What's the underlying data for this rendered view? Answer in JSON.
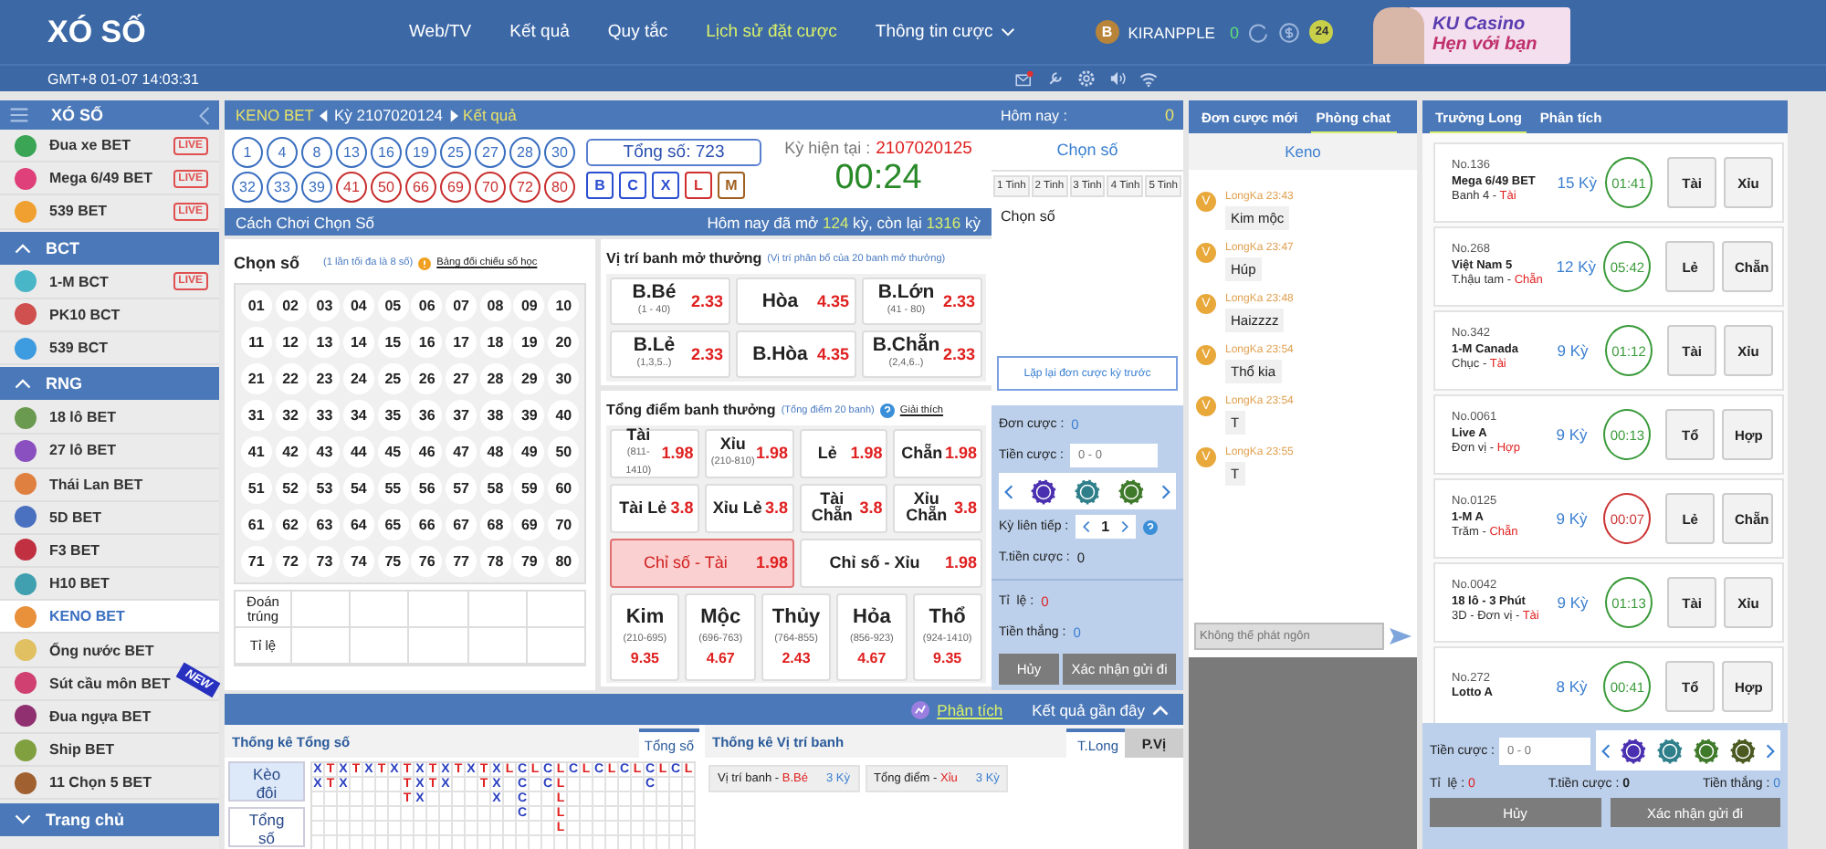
{
  "header": {
    "logo": "XÓ SỐ",
    "nav": [
      {
        "label": "Web/TV",
        "selected": false,
        "dropdown": false
      },
      {
        "label": "Kết quả",
        "selected": false,
        "dropdown": false
      },
      {
        "label": "Quy tắc",
        "selected": false,
        "dropdown": false
      },
      {
        "label": "Lịch sử đặt cược",
        "selected": true,
        "dropdown": false
      },
      {
        "label": "Thông tin cược",
        "selected": false,
        "dropdown": true
      }
    ],
    "user": {
      "initial": "B",
      "name": "KIRANPPLE",
      "balance": "0",
      "badge": "24"
    },
    "banner": {
      "title": "KU Casino",
      "subtitle": "Hẹn với bạn"
    },
    "clock": "GMT+8 01-07 14:03:31",
    "mail_unread": true
  },
  "sidebar": {
    "title": "XÓ SỐ",
    "footer": "Trang chủ",
    "groups": [
      {
        "items": [
          {
            "label": "Đua xe BET",
            "color": "#3aa655",
            "live": "LIVE",
            "selected": false
          },
          {
            "label": "Mega 6/49 BET",
            "color": "#e0407a",
            "live": "LIVE",
            "selected": false
          },
          {
            "label": "539 BET",
            "color": "#f0a030",
            "live": "LIVE",
            "selected": false
          }
        ]
      },
      {
        "title": "BCT",
        "expanded": true,
        "items": [
          {
            "label": "1-M BCT",
            "color": "#49b6c8",
            "live": "LIVE",
            "selected": false
          },
          {
            "label": "PK10 BCT",
            "color": "#d0504f",
            "selected": false
          },
          {
            "label": "539 BCT",
            "color": "#3d9be0",
            "selected": false
          }
        ]
      },
      {
        "title": "RNG",
        "expanded": true,
        "items": [
          {
            "label": "18 lô BET",
            "color": "#6a9a50",
            "selected": false
          },
          {
            "label": "27 lô BET",
            "color": "#8a50c0",
            "selected": false
          },
          {
            "label": "Thái Lan BET",
            "color": "#e08040",
            "selected": false
          },
          {
            "label": "5D BET",
            "color": "#4a70c0",
            "selected": false
          },
          {
            "label": "F3 BET",
            "color": "#c03040",
            "selected": false
          },
          {
            "label": "H10 BET",
            "color": "#40a0b0",
            "selected": false
          },
          {
            "label": "KENO BET",
            "color": "#e8903a",
            "selected": true
          },
          {
            "label": "Ống nước BET",
            "color": "#e0c060",
            "selected": false
          },
          {
            "label": "Sút cầu môn BET",
            "color": "#d04070",
            "new": "NEW",
            "selected": false
          },
          {
            "label": "Đua ngựa BET",
            "color": "#903070",
            "selected": false
          },
          {
            "label": "Ship BET",
            "color": "#80a040",
            "selected": false
          },
          {
            "label": "11 Chọn 5 BET",
            "color": "#a06030",
            "selected": false
          }
        ]
      }
    ]
  },
  "keno": {
    "breadcrumb": {
      "game": "KENO BET",
      "period": "Kỳ 2107020124",
      "result_link": "Kết quả"
    },
    "results": {
      "balls": [
        {
          "n": "1",
          "color": "#3a6fc0"
        },
        {
          "n": "4",
          "color": "#3a6fc0"
        },
        {
          "n": "8",
          "color": "#3a6fc0"
        },
        {
          "n": "13",
          "color": "#3a6fc0"
        },
        {
          "n": "16",
          "color": "#3a6fc0"
        },
        {
          "n": "19",
          "color": "#3a6fc0"
        },
        {
          "n": "25",
          "color": "#3a6fc0"
        },
        {
          "n": "27",
          "color": "#3a6fc0"
        },
        {
          "n": "28",
          "color": "#3a6fc0"
        },
        {
          "n": "30",
          "color": "#3a6fc0"
        },
        {
          "n": "32",
          "color": "#3a6fc0"
        },
        {
          "n": "33",
          "color": "#3a6fc0"
        },
        {
          "n": "39",
          "color": "#3a6fc0"
        },
        {
          "n": "41",
          "color": "#c83030"
        },
        {
          "n": "50",
          "color": "#c83030"
        },
        {
          "n": "66",
          "color": "#c83030"
        },
        {
          "n": "69",
          "color": "#c83030"
        },
        {
          "n": "70",
          "color": "#c83030"
        },
        {
          "n": "72",
          "color": "#c83030"
        },
        {
          "n": "80",
          "color": "#c83030"
        }
      ],
      "total": "Tổng số: 723",
      "flags": [
        {
          "label": "B",
          "color": "#2a4fd0"
        },
        {
          "label": "C",
          "color": "#2a4fd0"
        },
        {
          "label": "X",
          "color": "#2a4fd0"
        },
        {
          "label": "L",
          "color": "#d03030"
        },
        {
          "label": "M",
          "color": "#a06020"
        }
      ],
      "current_label": "Kỳ hiện tại :",
      "current_period": "2107020125",
      "countdown": "00:24"
    },
    "bar": {
      "title": "Cách Chơi Chọn Số",
      "stats": [
        {
          "text": "Hôm nay đã mở ",
          "highlight": false
        },
        {
          "text": "124",
          "highlight": true
        },
        {
          "text": " kỳ, còn lại ",
          "highlight": false
        },
        {
          "text": "1316",
          "highlight": true
        },
        {
          "text": " kỳ",
          "highlight": false
        }
      ]
    },
    "picker": {
      "title": "Chọn số",
      "hint": "(1 lần tối đa là 8 số)",
      "link": "Bảng đối chiếu số học",
      "numbers": [
        "01",
        "02",
        "03",
        "04",
        "05",
        "06",
        "07",
        "08",
        "09",
        "10",
        "11",
        "12",
        "13",
        "14",
        "15",
        "16",
        "17",
        "18",
        "19",
        "20",
        "21",
        "22",
        "23",
        "24",
        "25",
        "26",
        "27",
        "28",
        "29",
        "30",
        "31",
        "32",
        "33",
        "34",
        "35",
        "36",
        "37",
        "38",
        "39",
        "40",
        "41",
        "42",
        "43",
        "44",
        "45",
        "46",
        "47",
        "48",
        "49",
        "50",
        "51",
        "52",
        "53",
        "54",
        "55",
        "56",
        "57",
        "58",
        "59",
        "60",
        "61",
        "62",
        "63",
        "64",
        "65",
        "66",
        "67",
        "68",
        "69",
        "70",
        "71",
        "72",
        "73",
        "74",
        "75",
        "76",
        "77",
        "78",
        "79",
        "80"
      ],
      "hit_label": "Đoán trúng",
      "rate_label": "Tỉ lệ"
    },
    "positions": {
      "title": "Vị trí banh mở thưởng",
      "note": "(Vị trí phân bổ của 20 banh mở thưởng)",
      "bets": [
        {
          "name": "B.Bé",
          "range": "(1 - 40)",
          "odds": "2.33",
          "selected": false
        },
        {
          "name": "Hòa",
          "odds": "4.35",
          "selected": false
        },
        {
          "name": "B.Lớn",
          "range": "(41 - 80)",
          "odds": "2.33",
          "selected": false
        },
        {
          "name": "B.Lẻ",
          "range": "(1,3,5..)",
          "odds": "2.33",
          "selected": false
        },
        {
          "name": "B.Hòa",
          "odds": "4.35",
          "selected": false
        },
        {
          "name": "B.Chẵn",
          "range": "(2,4,6..)",
          "odds": "2.33",
          "selected": false
        }
      ]
    },
    "totals": {
      "title": "Tổng điểm banh thưởng",
      "note": "(Tổng điểm 20 banh)",
      "help_link": "Giải thích",
      "main_bets": [
        {
          "kind": "plain",
          "name": "Tài",
          "range": "(811-1410)",
          "odds": "1.98",
          "selected": false
        },
        {
          "kind": "plain",
          "name": "Xỉu",
          "range": "(210-810)",
          "odds": "1.98",
          "selected": false
        },
        {
          "kind": "plain",
          "name": "Lẻ",
          "odds": "1.98",
          "selected": false
        },
        {
          "kind": "plain",
          "name": "Chẵn",
          "odds": "1.98",
          "selected": false
        }
      ],
      "combo_bets": [
        {
          "kind": "plain",
          "name": "Tài Lẻ",
          "odds": "3.8",
          "selected": false
        },
        {
          "kind": "plain",
          "name": "Xỉu Lẻ",
          "odds": "3.8",
          "selected": false
        },
        {
          "kind": "plain",
          "name": "Tài Chẵn",
          "odds": "3.8",
          "selected": false
        },
        {
          "kind": "plain",
          "name": "Xỉu Chẵn",
          "odds": "3.8",
          "selected": false
        }
      ],
      "index_bets": [
        {
          "kind": "plain",
          "name": "Chỉ số - Tài",
          "odds": "1.98",
          "selected": true
        },
        {
          "kind": "plain",
          "name": "Chỉ số - Xỉu",
          "odds": "1.98",
          "selected": false
        }
      ],
      "element_bets": [
        {
          "kind": "element",
          "name": "Kim",
          "range": "(210-695)",
          "odds": "9.35",
          "selected": false
        },
        {
          "kind": "element",
          "name": "Mộc",
          "range": "(696-763)",
          "odds": "4.67",
          "selected": false
        },
        {
          "kind": "element",
          "name": "Thủy",
          "range": "(764-855)",
          "odds": "2.43",
          "selected": false
        },
        {
          "kind": "element",
          "name": "Hỏa",
          "range": "(856-923)",
          "odds": "4.67",
          "selected": false
        },
        {
          "kind": "element",
          "name": "Thổ",
          "range": "(924-1410)",
          "odds": "9.35",
          "selected": false
        }
      ]
    },
    "betslip": {
      "header_label": "Hôm nay :",
      "header_value": "0",
      "title": "Chọn số",
      "tabs": [
        "1 Tinh",
        "2 Tinh",
        "3 Tinh",
        "4 Tinh",
        "5 Tinh"
      ],
      "picked_label": "Chọn số",
      "repeat_button": "Lặp lại đơn cược kỳ trước",
      "orders_label": "Đơn cược :",
      "orders_value": "0",
      "amount_label": "Tiền cược :",
      "amount_placeholder": "0 - 0",
      "streak_label": "Kỳ liên tiếp :",
      "streak_value": "1",
      "total_label": "T.tiền cược :",
      "total_value": "0",
      "rate_label": "Tỉ  lệ :",
      "rate_value": "0",
      "win_label": "Tiền thắng :",
      "win_value": "0",
      "cancel": "Hủy",
      "confirm": "Xác nhận gửi đi"
    },
    "recent_bar": {
      "analysis_link": "Phân tích",
      "recent": "Kết quả gần đây"
    },
    "stats": {
      "title": "Thống kê Tổng số",
      "tabs": [
        {
          "label": "Tổng số",
          "selected": true
        }
      ],
      "side_buttons": [
        {
          "label": "Kèo đôi",
          "selected": true
        },
        {
          "label": "Tổng số",
          "selected": false
        }
      ],
      "road": [
        {
          "letters": "XX",
          "color": "#2a3fc0"
        },
        {
          "letters": "TT",
          "color": "#e02020"
        },
        {
          "letters": "XX",
          "color": "#2a3fc0"
        },
        {
          "letters": "T",
          "color": "#e02020"
        },
        {
          "letters": "X",
          "color": "#2a3fc0"
        },
        {
          "letters": "T",
          "color": "#e02020"
        },
        {
          "letters": "X",
          "color": "#2a3fc0"
        },
        {
          "letters": "TTT",
          "color": "#e02020"
        },
        {
          "letters": "XXX",
          "color": "#2a3fc0"
        },
        {
          "letters": "TT",
          "color": "#e02020"
        },
        {
          "letters": "XX",
          "color": "#2a3fc0"
        },
        {
          "letters": "T",
          "color": "#e02020"
        },
        {
          "letters": "X",
          "color": "#2a3fc0"
        },
        {
          "letters": "TT",
          "color": "#e02020"
        },
        {
          "letters": "XXX",
          "color": "#2a3fc0"
        },
        {
          "letters": "L",
          "color": "#e02020"
        },
        {
          "letters": "CCCC",
          "color": "#2a3fc0"
        },
        {
          "letters": "L",
          "color": "#e02020"
        },
        {
          "letters": "CC",
          "color": "#2a3fc0"
        },
        {
          "letters": "LLLLL",
          "color": "#e02020"
        },
        {
          "letters": "C",
          "color": "#2a3fc0"
        },
        {
          "letters": "L",
          "color": "#e02020"
        },
        {
          "letters": "C",
          "color": "#2a3fc0"
        },
        {
          "letters": "L",
          "color": "#e02020"
        },
        {
          "letters": "C",
          "color": "#2a3fc0"
        },
        {
          "letters": "L",
          "color": "#e02020"
        },
        {
          "letters": "CC",
          "color": "#2a3fc0"
        },
        {
          "letters": "L",
          "color": "#e02020"
        },
        {
          "letters": "C",
          "color": "#2a3fc0"
        },
        {
          "letters": "L",
          "color": "#e02020"
        }
      ]
    },
    "position_stats": {
      "title": "Thống kê Vị trí banh",
      "tabs": [
        {
          "label": "T.Long",
          "selected": true
        },
        {
          "label": "P.Vị",
          "selected": false
        }
      ],
      "chips": [
        {
          "label": "Vị trí banh -",
          "value": "B.Bé",
          "count": "3 Kỳ"
        },
        {
          "label": "Tổng điểm -",
          "value": "Xỉu",
          "count": "3 Kỳ"
        }
      ]
    }
  },
  "chat": {
    "tabs": [
      {
        "label": "Đơn cược mới",
        "selected": false
      },
      {
        "label": "Phòng chat",
        "selected": true
      }
    ],
    "room": "Keno",
    "messages": [
      {
        "avatar": "V",
        "user": "LongKa",
        "time": "23:43",
        "text": "Kim mộc"
      },
      {
        "avatar": "V",
        "user": "LongKa",
        "time": "23:47",
        "text": "Húp"
      },
      {
        "avatar": "V",
        "user": "LongKa",
        "time": "23:48",
        "text": "Haizzzz"
      },
      {
        "avatar": "V",
        "user": "LongKa",
        "time": "23:54",
        "text": "Thổ kia"
      },
      {
        "avatar": "V",
        "user": "LongKa",
        "time": "23:54",
        "text": "T"
      },
      {
        "avatar": "V",
        "user": "LongKa",
        "time": "23:55",
        "text": "T"
      }
    ],
    "input_placeholder": "Không thể phát ngôn"
  },
  "streaks": {
    "tabs": [
      {
        "label": "Trường Long",
        "selected": true
      },
      {
        "label": "Phân tích",
        "selected": false
      }
    ],
    "cards": [
      {
        "no": "No.136",
        "name": "Mega 6/49 BET",
        "detail": "Banh 4 -",
        "result": "Tài",
        "count": "15 Kỳ",
        "timer": "01:41",
        "color": "#3a9a3a",
        "options": [
          "Tài",
          "Xỉu"
        ]
      },
      {
        "no": "No.268",
        "name": "Việt Nam 5",
        "detail": "T.hậu tam -",
        "result": "Chẵn",
        "count": "12 Kỳ",
        "timer": "05:42",
        "color": "#3a9a3a",
        "options": [
          "Lẻ",
          "Chẵn"
        ]
      },
      {
        "no": "No.342",
        "name": "1-M Canada",
        "detail": "Chục -",
        "result": "Tài",
        "count": "9 Kỳ",
        "timer": "01:12",
        "color": "#3a9a3a",
        "options": [
          "Tài",
          "Xỉu"
        ]
      },
      {
        "no": "No.0061",
        "name": "Live A",
        "detail": "Đơn vị -",
        "result": "Hợp",
        "count": "9 Kỳ",
        "timer": "00:13",
        "color": "#3a9a3a",
        "options": [
          "Tổ",
          "Hợp"
        ]
      },
      {
        "no": "No.0125",
        "name": "1-M A",
        "detail": "Trăm -",
        "result": "Chẵn",
        "count": "9 Kỳ",
        "timer": "00:07",
        "color": "#cc3333",
        "options": [
          "Lẻ",
          "Chẵn"
        ]
      },
      {
        "no": "No.0042",
        "name": "18 lô - 3 Phút",
        "detail": "3D - Đơn vị -",
        "result": "Tài",
        "count": "9 Kỳ",
        "timer": "01:13",
        "color": "#3a9a3a",
        "options": [
          "Tài",
          "Xỉu"
        ]
      },
      {
        "no": "No.272",
        "name": "Lotto A",
        "count": "8 Kỳ",
        "timer": "00:41",
        "color": "#3a9a3a",
        "options": [
          "Tổ",
          "Hợp"
        ]
      }
    ],
    "form": {
      "amount_label": "Tiền cược :",
      "amount_placeholder": "0 - 0",
      "rate_label": "Tỉ  lệ :",
      "rate_value": "0",
      "total_label": "T.tiền cược :",
      "total_value": "0",
      "win_label": "Tiền thắng :",
      "win_value": "0",
      "cancel": "Hủy",
      "confirm": "Xác nhận gửi đi"
    }
  }
}
